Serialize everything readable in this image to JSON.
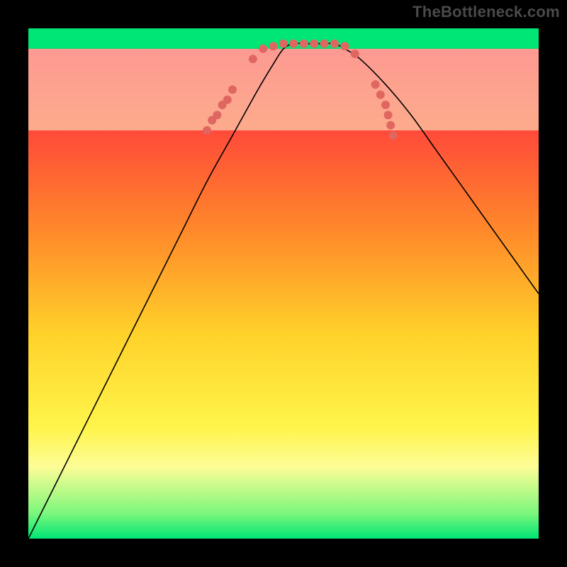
{
  "watermark": "TheBottleneck.com",
  "chart_data": {
    "type": "line",
    "title": "",
    "xlabel": "",
    "ylabel": "",
    "xlim": [
      0,
      100
    ],
    "ylim": [
      0,
      100
    ],
    "grid": false,
    "legend": false,
    "background_gradient": {
      "stops": [
        {
          "pos": 0.0,
          "color": "#ff1a4b"
        },
        {
          "pos": 0.2,
          "color": "#ff4a3a"
        },
        {
          "pos": 0.4,
          "color": "#ff8a2a"
        },
        {
          "pos": 0.6,
          "color": "#ffd22a"
        },
        {
          "pos": 0.78,
          "color": "#fff44a"
        },
        {
          "pos": 0.86,
          "color": "#fdfd96"
        },
        {
          "pos": 0.95,
          "color": "#7cf77c"
        },
        {
          "pos": 1.0,
          "color": "#00e676"
        }
      ]
    },
    "green_band": {
      "y_top": 96,
      "y_bottom": 100,
      "color": "#00e676"
    },
    "pale_band": {
      "y_top": 80,
      "y_bottom": 96,
      "color": "#fbfccf"
    },
    "series": [
      {
        "name": "bottleneck-curve",
        "color": "#000000",
        "stroke_width": 1.6,
        "x": [
          0,
          5,
          10,
          15,
          20,
          25,
          30,
          35,
          40,
          45,
          48,
          50,
          52,
          55,
          58,
          60,
          62,
          65,
          70,
          75,
          80,
          85,
          90,
          95,
          100
        ],
        "y": [
          0,
          10,
          20,
          30,
          40,
          50,
          60,
          70,
          79,
          88,
          93,
          96,
          97,
          97,
          97,
          97,
          96,
          94,
          89,
          83,
          76,
          69,
          62,
          55,
          48
        ]
      },
      {
        "name": "dot-cluster",
        "type": "scatter",
        "color": "#e06661",
        "radius": 6,
        "points": [
          {
            "x": 35,
            "y": 80
          },
          {
            "x": 36,
            "y": 82
          },
          {
            "x": 37,
            "y": 83
          },
          {
            "x": 38,
            "y": 85
          },
          {
            "x": 39,
            "y": 86
          },
          {
            "x": 40,
            "y": 88
          },
          {
            "x": 44,
            "y": 94
          },
          {
            "x": 46,
            "y": 96
          },
          {
            "x": 48,
            "y": 96.5
          },
          {
            "x": 50,
            "y": 97
          },
          {
            "x": 52,
            "y": 97
          },
          {
            "x": 54,
            "y": 97
          },
          {
            "x": 56,
            "y": 97
          },
          {
            "x": 58,
            "y": 97
          },
          {
            "x": 60,
            "y": 97
          },
          {
            "x": 62,
            "y": 96.5
          },
          {
            "x": 64,
            "y": 95
          },
          {
            "x": 68,
            "y": 89
          },
          {
            "x": 69,
            "y": 87
          },
          {
            "x": 70,
            "y": 85
          },
          {
            "x": 70.5,
            "y": 83
          },
          {
            "x": 71,
            "y": 81
          },
          {
            "x": 71.5,
            "y": 79
          }
        ]
      }
    ]
  }
}
